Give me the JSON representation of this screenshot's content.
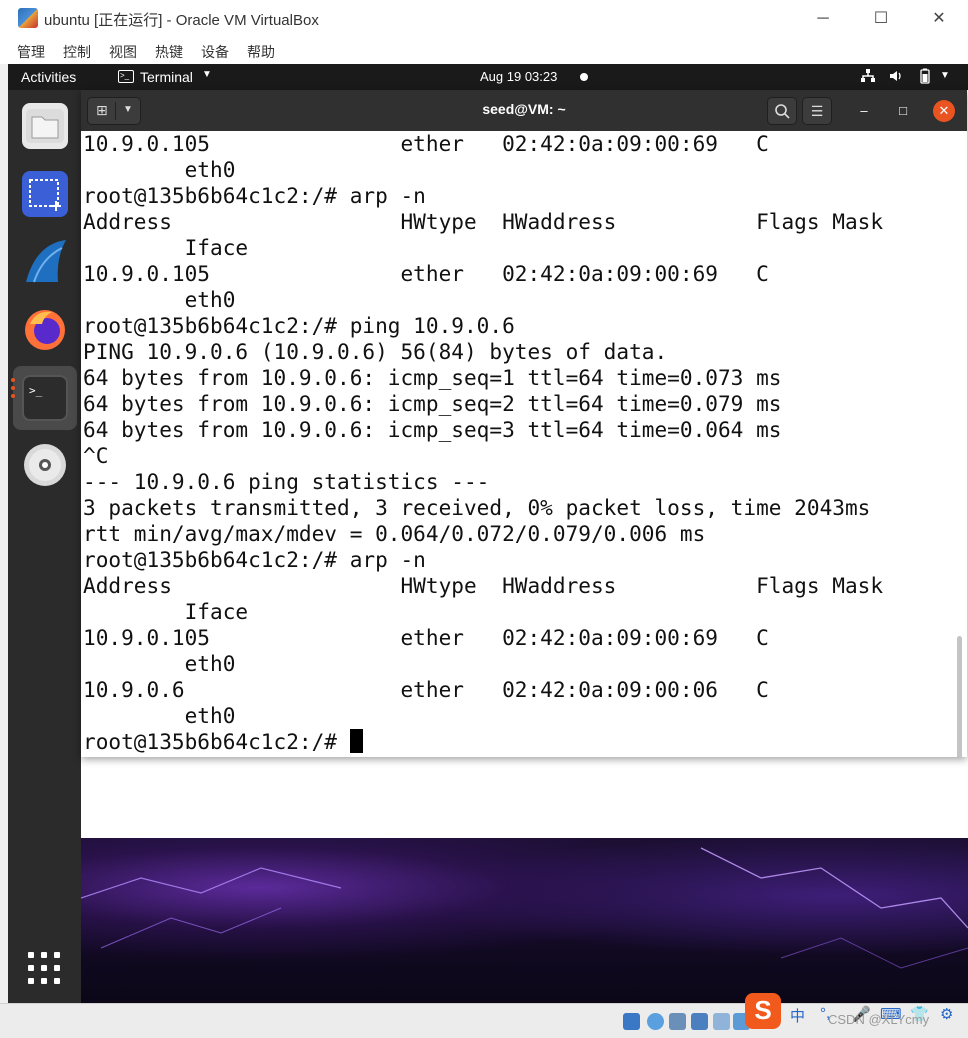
{
  "host_window": {
    "title": "ubuntu [正在运行] - Oracle VM VirtualBox",
    "menu": [
      "管理",
      "控制",
      "视图",
      "热键",
      "设备",
      "帮助"
    ],
    "minimize_glyph": "─",
    "maximize_glyph": "☐",
    "close_glyph": "✕"
  },
  "ubuntu_topbar": {
    "activities": "Activities",
    "app_name": "Terminal",
    "clock": "Aug 19  03:23",
    "chevron": "▼",
    "icons": [
      "network-icon",
      "volume-icon",
      "battery-icon",
      "system-menu-chevron-icon"
    ]
  },
  "dock": {
    "apps": [
      "files-icon",
      "screenshot-icon",
      "wireshark-icon",
      "firefox-icon",
      "terminal-icon",
      "dvd-icon"
    ],
    "active": "terminal-icon",
    "show_apps": "show-applications-icon"
  },
  "terminal": {
    "title": "seed@VM: ~",
    "search_glyph": "⌕",
    "menu_glyph": "☰",
    "minimize_glyph": "–",
    "maximize_glyph": "□",
    "close_glyph": "✕",
    "lines": [
      "10.9.0.105               ether   02:42:0a:09:00:69   C",
      "        eth0",
      "root@135b6b64c1c2:/# arp -n",
      "Address                  HWtype  HWaddress           Flags Mask",
      "        Iface",
      "10.9.0.105               ether   02:42:0a:09:00:69   C",
      "        eth0",
      "root@135b6b64c1c2:/# ping 10.9.0.6",
      "PING 10.9.0.6 (10.9.0.6) 56(84) bytes of data.",
      "64 bytes from 10.9.0.6: icmp_seq=1 ttl=64 time=0.073 ms",
      "64 bytes from 10.9.0.6: icmp_seq=2 ttl=64 time=0.079 ms",
      "64 bytes from 10.9.0.6: icmp_seq=3 ttl=64 time=0.064 ms",
      "^C",
      "--- 10.9.0.6 ping statistics ---",
      "3 packets transmitted, 3 received, 0% packet loss, time 2043ms",
      "rtt min/avg/max/mdev = 0.064/0.072/0.079/0.006 ms",
      "root@135b6b64c1c2:/# arp -n",
      "Address                  HWtype  HWaddress           Flags Mask",
      "        Iface",
      "10.9.0.105               ether   02:42:0a:09:00:69   C",
      "        eth0",
      "10.9.0.6                 ether   02:42:0a:09:00:06   C",
      "        eth0"
    ],
    "prompt": "root@135b6b64c1c2:/# "
  },
  "statusbar": {
    "ime_logo": "S",
    "ime_lang": "中",
    "watermark": "CSDN @XLYcmy"
  },
  "colors": {
    "ubuntu_orange": "#e95420",
    "topbar": "#1a1a1a",
    "dock": "#2b2b2b",
    "terminal_header": "#303030"
  }
}
